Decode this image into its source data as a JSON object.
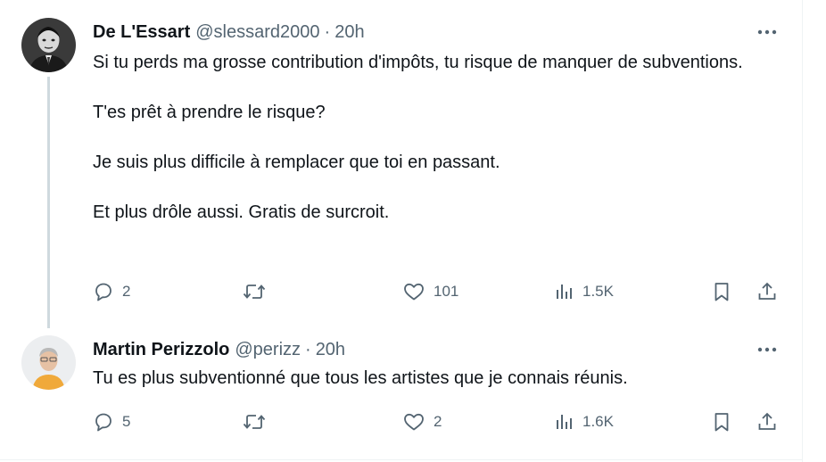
{
  "tweets": [
    {
      "display_name": "De L'Essart",
      "handle": "@slessard2000",
      "separator": "·",
      "time": "20h",
      "body": [
        "Si tu perds ma grosse contribution d'impôts, tu risque de manquer de subventions.",
        "T'es prêt à prendre le risque?",
        "Je suis plus difficile à remplacer que toi en passant.",
        "Et plus drôle aussi. Gratis de surcroit."
      ],
      "replies": "2",
      "retweets": "",
      "likes": "101",
      "views": "1.5K"
    },
    {
      "display_name": "Martin Perizzolo",
      "handle": "@perizz",
      "separator": "·",
      "time": "20h",
      "body": [
        "Tu es plus subventionné que tous les artistes que je connais réunis."
      ],
      "replies": "5",
      "retweets": "",
      "likes": "2",
      "views": "1.6K"
    }
  ],
  "icons": {
    "more": "more-horizontal-icon",
    "reply": "reply-bubble-icon",
    "retweet": "retweet-icon",
    "like": "heart-icon",
    "views": "views-bar-chart-icon",
    "bookmark": "bookmark-icon",
    "share": "share-upload-icon"
  },
  "colors": {
    "text_primary": "#0f1419",
    "text_secondary": "#536471",
    "thread_line": "#cfd9de",
    "border": "#eff3f4"
  }
}
